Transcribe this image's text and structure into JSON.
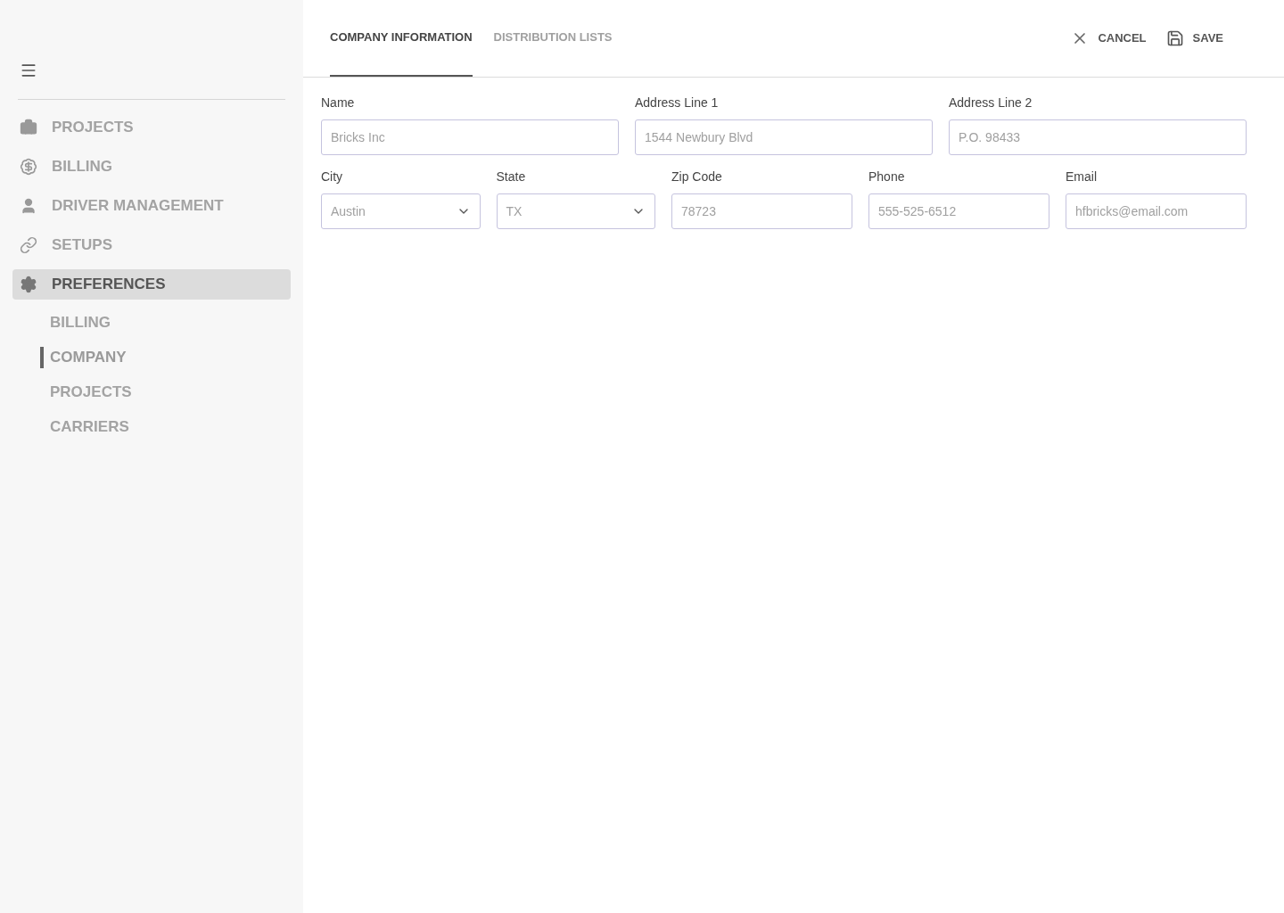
{
  "sidebar": {
    "items": [
      {
        "label": "PROJECTS",
        "selected": false
      },
      {
        "label": "BILLING",
        "selected": false
      },
      {
        "label": "DRIVER MANAGEMENT",
        "selected": false
      },
      {
        "label": "SETUPS",
        "selected": false
      },
      {
        "label": "PREFERENCES",
        "selected": true,
        "children": [
          {
            "label": "BILLING",
            "selected": false
          },
          {
            "label": "COMPANY",
            "selected": true
          },
          {
            "label": "PROJECTS",
            "selected": false
          },
          {
            "label": "CARRIERS",
            "selected": false
          }
        ]
      }
    ]
  },
  "tabs": [
    {
      "label": "COMPANY INFORMATION",
      "selected": true
    },
    {
      "label": "DISTRIBUTION LISTS",
      "selected": false
    }
  ],
  "actions": [
    {
      "label": "CANCEL",
      "kind": "cancel"
    },
    {
      "label": "SAVE",
      "kind": "save"
    }
  ],
  "form": {
    "address_fields": [
      {
        "label": "Name",
        "placeholder": "Bricks Inc",
        "kind": "text"
      },
      {
        "label": "Address Line 1",
        "placeholder": "1544 Newbury Blvd",
        "kind": "text"
      },
      {
        "label": "Address Line 2",
        "placeholder": "P.O. 98433",
        "kind": "text"
      }
    ],
    "contact_fields": [
      {
        "label": "City",
        "placeholder": "Austin",
        "kind": "select"
      },
      {
        "label": "State",
        "placeholder": "TX",
        "kind": "select"
      },
      {
        "label": "Zip Code",
        "placeholder": "78723",
        "kind": "text"
      },
      {
        "label": "Phone",
        "placeholder": "555-525-6512",
        "kind": "text"
      },
      {
        "label": "Email",
        "placeholder": "hfbricks@email.com",
        "kind": "text"
      }
    ]
  }
}
